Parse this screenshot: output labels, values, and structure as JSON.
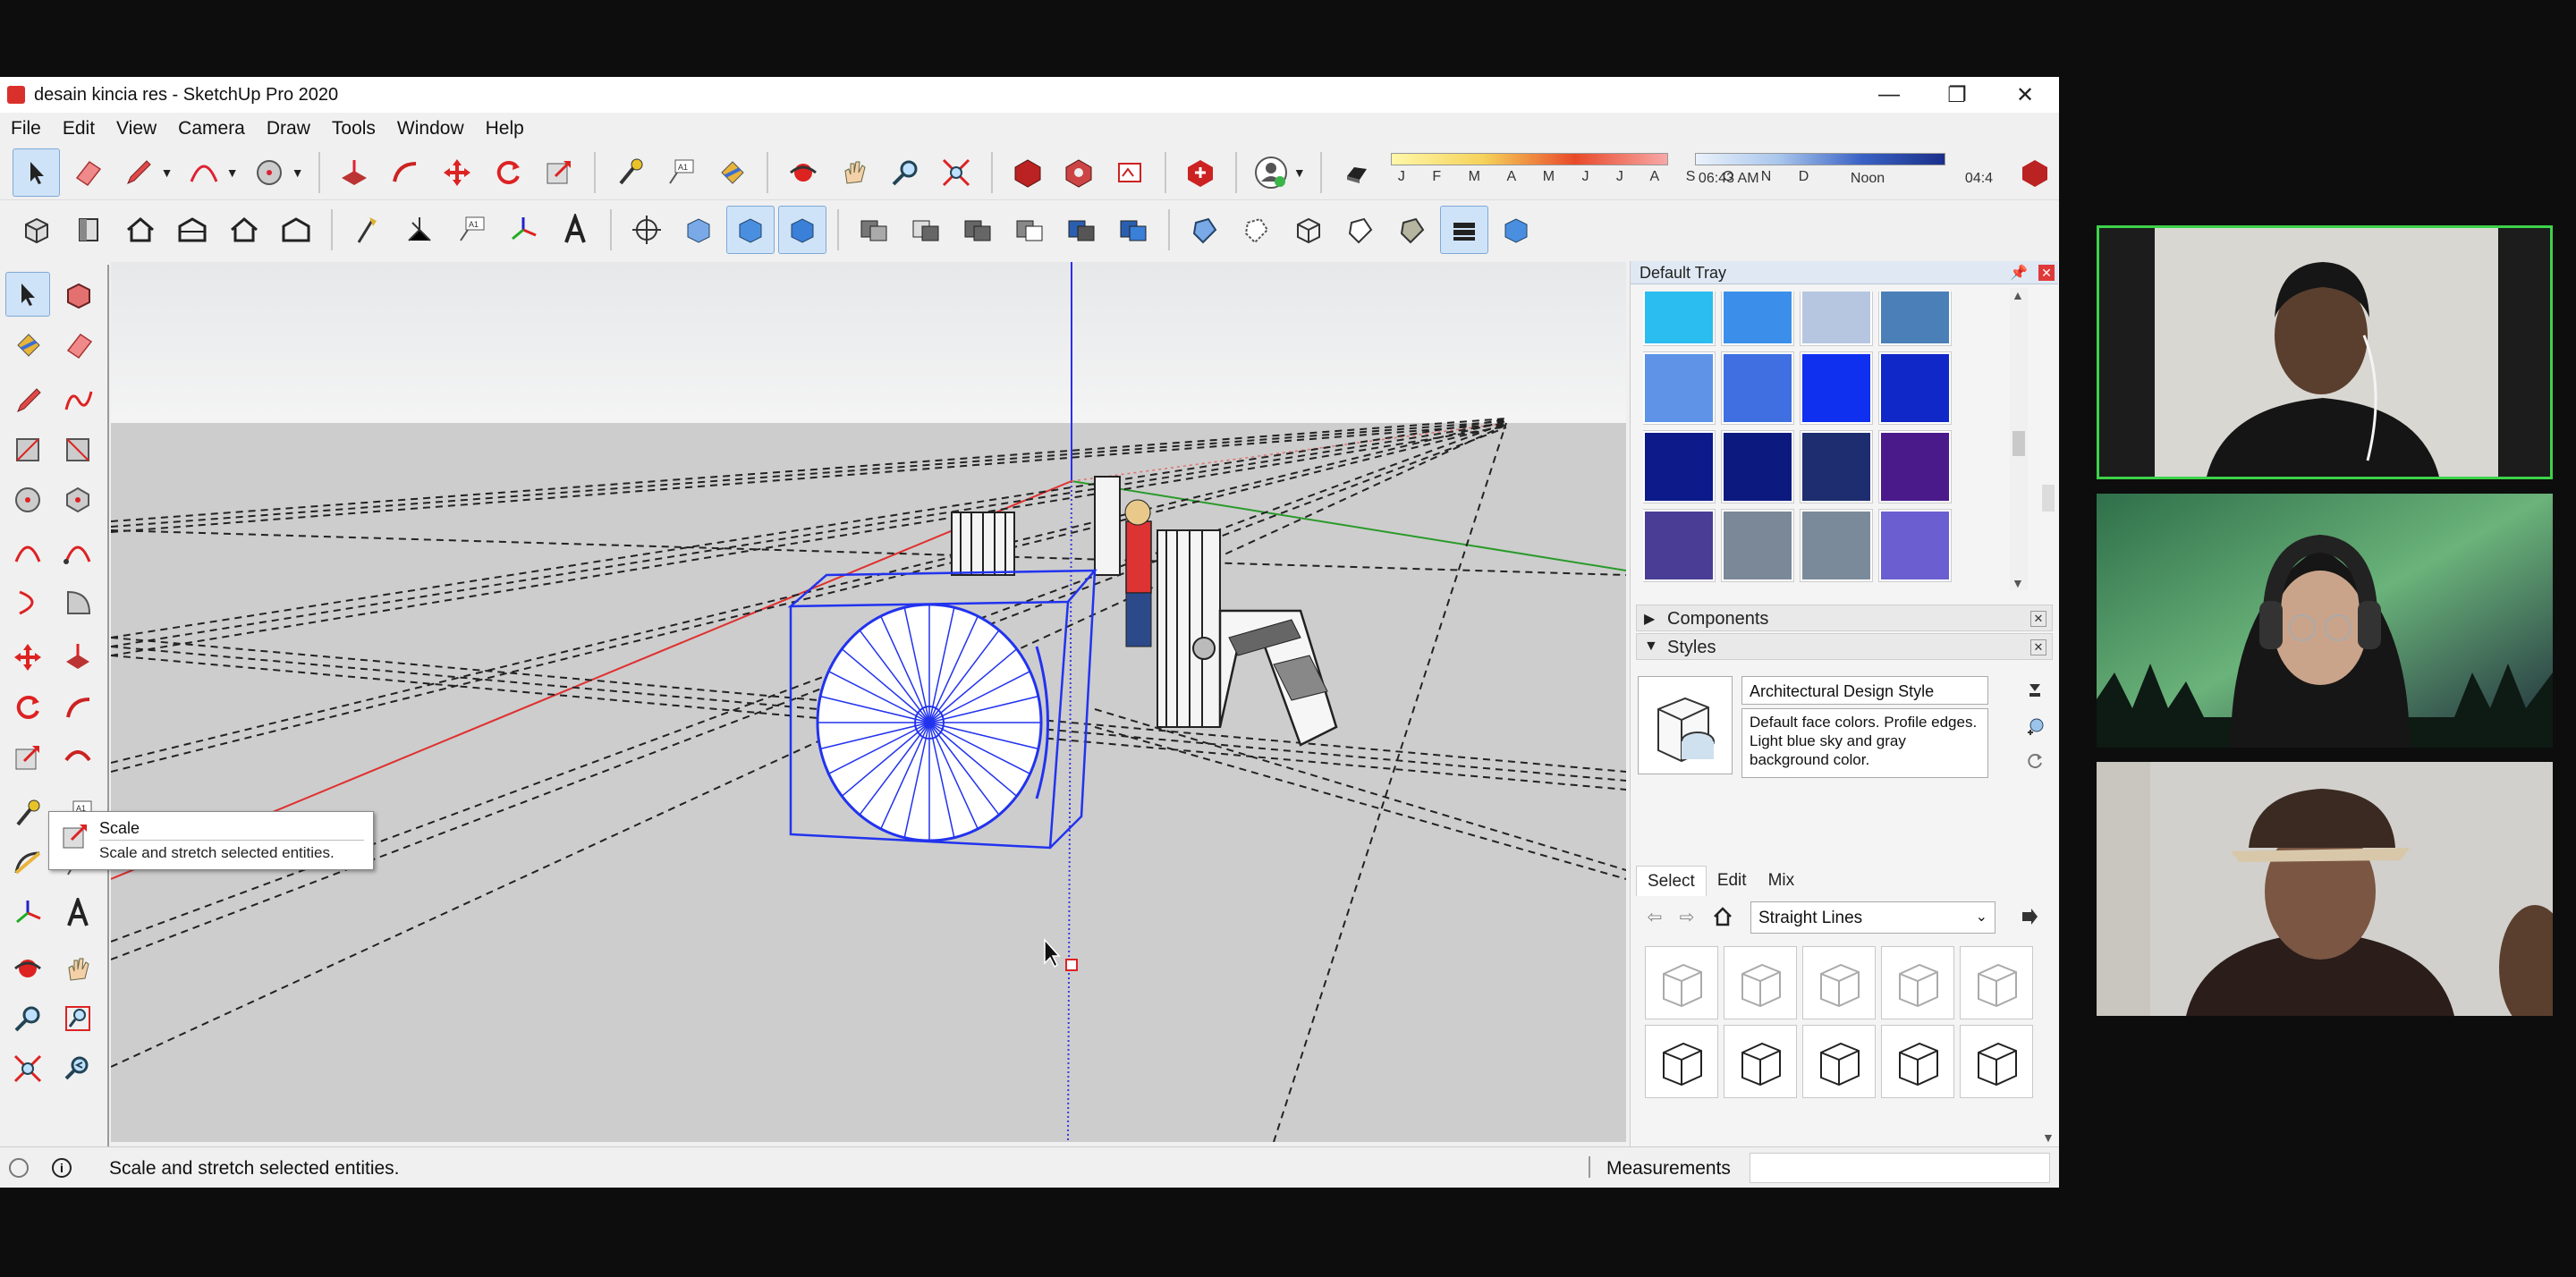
{
  "window": {
    "title": "desain kincia res - SketchUp Pro 2020",
    "controls": [
      "—",
      "❐",
      "✕"
    ]
  },
  "menu": [
    "File",
    "Edit",
    "View",
    "Camera",
    "Draw",
    "Tools",
    "Window",
    "Help"
  ],
  "shadow_settings": {
    "months": "J F M A M J J A S O N D",
    "time_start": "06:43 AM",
    "time_mid": "Noon",
    "time_end": "04:4"
  },
  "tooltip": {
    "title": "Scale",
    "description": "Scale and stretch selected entities."
  },
  "tray": {
    "title": "Default Tray",
    "colors": [
      "#2bbcf0",
      "#3b8fea",
      "#b6c6e0",
      "#4a7fb8",
      "#5e93e8",
      "#3f6fe0",
      "#1030f0",
      "#1028c8",
      "#0c1a8a",
      "#0c1a80",
      "#1e2d70",
      "#4a1a8a",
      "#4a3d96",
      "#7a8898",
      "#7a8a9a",
      "#6a5ed0"
    ],
    "sections": {
      "components": "Components",
      "styles": "Styles"
    },
    "style_name": "Architectural Design Style",
    "style_description": "Default face colors. Profile edges. Light blue sky and gray background color.",
    "tabs": [
      "Select",
      "Edit",
      "Mix"
    ],
    "style_collection": "Straight Lines"
  },
  "status": {
    "message": "Scale and stretch selected entities.",
    "measurements_label": "Measurements",
    "measurements_value": ""
  },
  "icons": {
    "select": "select-arrow-icon",
    "eraser": "eraser-icon",
    "pencil": "pencil-icon"
  }
}
